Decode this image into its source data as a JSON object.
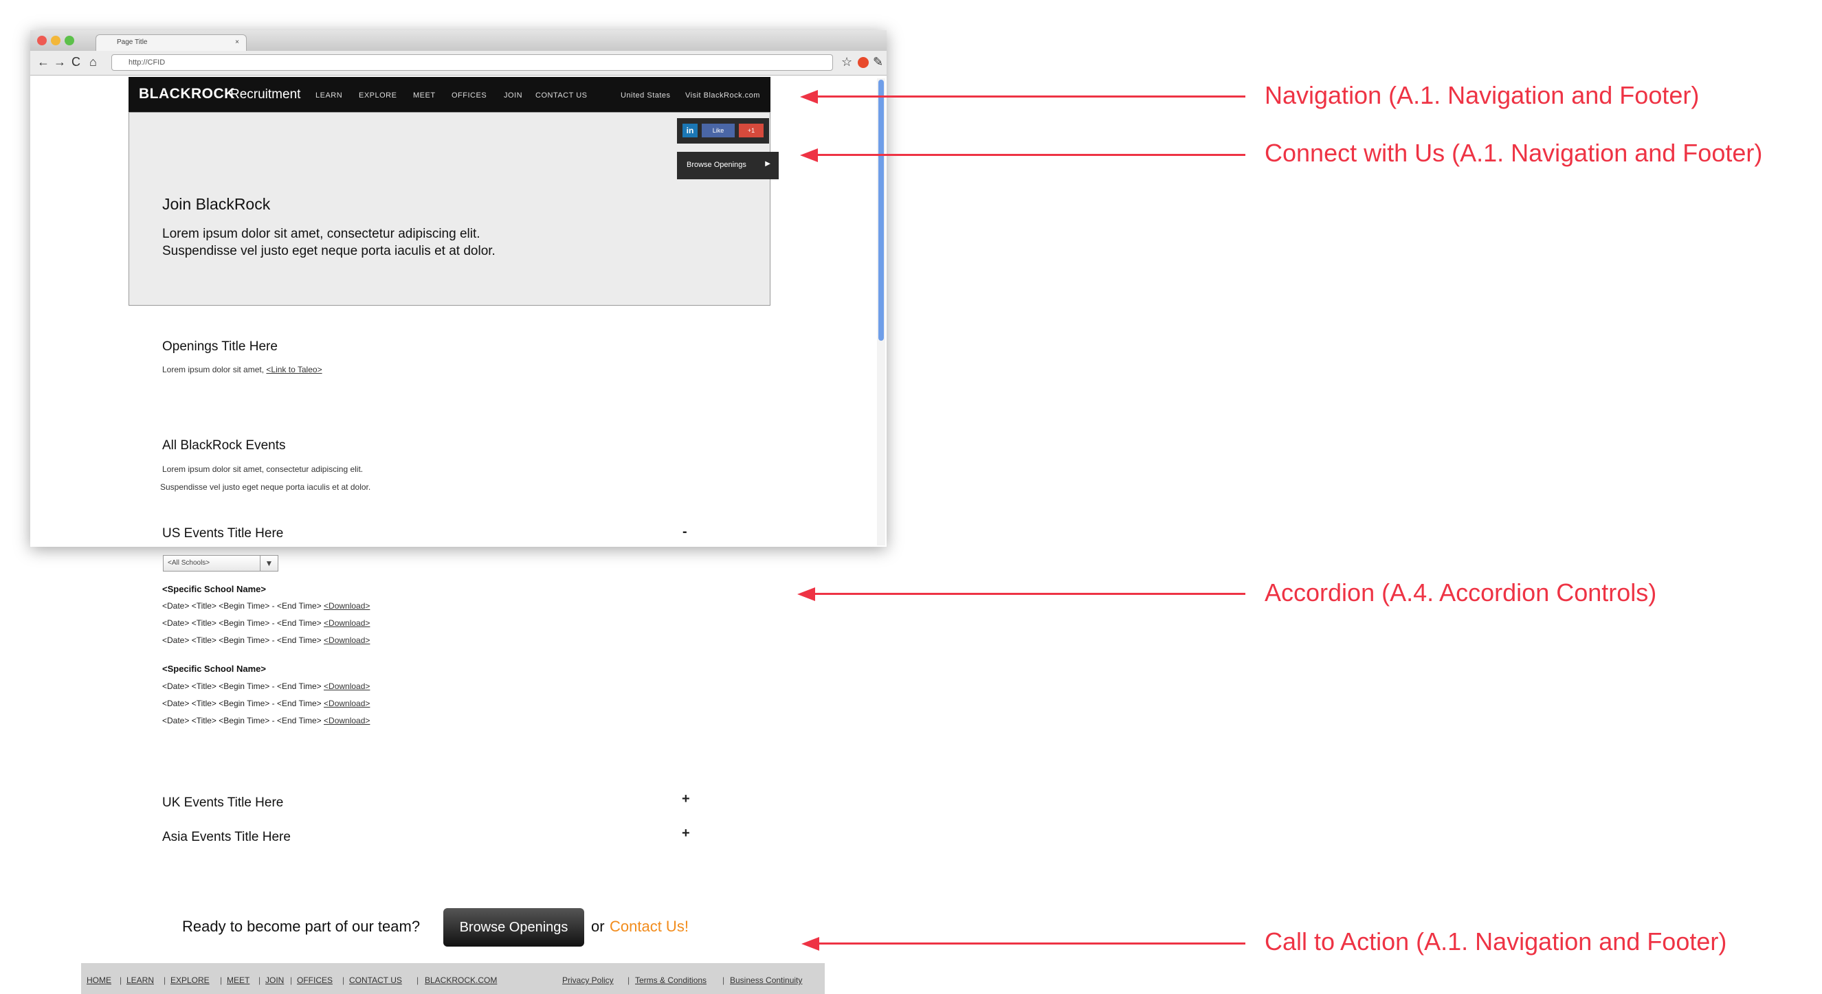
{
  "browser": {
    "tab_title": "Page Title",
    "url": "http://CFID"
  },
  "site": {
    "logo": "BLACKROCK",
    "logo_sub": "Recruitment",
    "nav": [
      "LEARN",
      "EXPLORE",
      "MEET",
      "OFFICES",
      "JOIN",
      "CONTACT US"
    ],
    "nav_right": [
      "United States",
      "Visit BlackRock.com"
    ],
    "social": [
      "in",
      "Like",
      "+1"
    ],
    "hero_button": "Browse Openings",
    "hero_title": "Join BlackRock",
    "hero_text": "Lorem ipsum dolor sit amet, consectetur adipiscing elit. Suspendisse vel justo eget neque porta iaculis et at dolor.",
    "openings_title": "Openings Title Here",
    "openings_text": "Lorem ipsum dolor sit amet,",
    "openings_link": "<Link to Taleo>",
    "events_title": "All BlackRock Events",
    "events_text_1": "Lorem ipsum dolor sit amet, consectetur adipiscing elit.",
    "events_text_2": "Suspendisse vel justo eget neque porta iaculis et at dolor.",
    "us_title": "US Events Title Here",
    "us_toggle": "-",
    "school_select": "<All Schools>",
    "schools": [
      {
        "name": "<Specific School Name>",
        "rows": [
          {
            "text": "<Date> <Title> <Begin Time> - <End Time>",
            "link": "<Download>"
          },
          {
            "text": "<Date> <Title> <Begin Time> - <End Time>",
            "link": "<Download>"
          },
          {
            "text": "<Date> <Title> <Begin Time> - <End Time>",
            "link": "<Download>"
          }
        ]
      },
      {
        "name": "<Specific School Name>",
        "rows": [
          {
            "text": "<Date> <Title> <Begin Time> - <End Time>",
            "link": "<Download>"
          },
          {
            "text": "<Date> <Title> <Begin Time> - <End Time>",
            "link": "<Download>"
          },
          {
            "text": "<Date> <Title> <Begin Time> - <End Time>",
            "link": "<Download>"
          }
        ]
      }
    ],
    "uk_title": "UK Events Title Here",
    "uk_toggle": "+",
    "asia_title": "Asia Events Title Here",
    "asia_toggle": "+",
    "cta_text": "Ready to become part of our team?",
    "cta_button": "Browse Openings",
    "cta_or": "or",
    "cta_contact": "Contact Us!",
    "footer_links": [
      "HOME",
      "LEARN",
      "EXPLORE",
      "MEET",
      "JOIN",
      "OFFICES",
      "CONTACT US",
      "BLACKROCK.COM"
    ],
    "footer_right": [
      "Privacy Policy",
      "Terms & Conditions",
      "Business Continuity"
    ]
  },
  "annotations": [
    "Navigation (A.1. Navigation and Footer)",
    "Connect with Us (A.1. Navigation and Footer)",
    "Accordion (A.4. Accordion Controls)",
    "Call to Action (A.1. Navigation and Footer)"
  ],
  "colors": {
    "annotation": "#ee3344",
    "nav_bg": "#111111",
    "hero_bg": "#ececec",
    "contact_link": "#f28c1c",
    "footer_bg": "#d3d3d3"
  },
  "icons": [
    "back-icon",
    "forward-icon",
    "reload-icon",
    "home-icon",
    "star-icon",
    "wrench-icon",
    "chevron-down-icon",
    "play-arrow-icon"
  ]
}
